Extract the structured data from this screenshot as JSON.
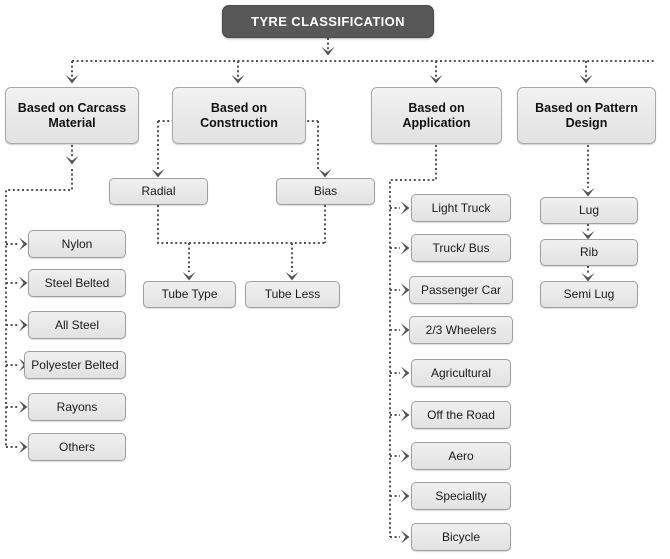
{
  "diagram": {
    "title": "TYRE CLASSIFICATION",
    "colors": {
      "root_bg": "#585858",
      "root_text": "#ffffff",
      "box_bg": "#eaeaea",
      "box_border": "#a8a8a8",
      "connector": "#5a5a5a",
      "page_bg": "#ffffff"
    },
    "categories": [
      {
        "label": "Based on Carcass Material"
      },
      {
        "label": "Based on Construction"
      },
      {
        "label": "Based on Application"
      },
      {
        "label": "Based on Pattern Design"
      }
    ],
    "carcass_material": {
      "heading": "Based on Carcass Material",
      "items": [
        {
          "label": "Nylon"
        },
        {
          "label": "Steel Belted"
        },
        {
          "label": "All Steel"
        },
        {
          "label": "Polyester Belted"
        },
        {
          "label": "Rayons"
        },
        {
          "label": "Others"
        }
      ]
    },
    "construction": {
      "heading": "Based on Construction",
      "types": [
        {
          "label": "Radial"
        },
        {
          "label": "Bias"
        }
      ],
      "subtypes": [
        {
          "label": "Tube Type"
        },
        {
          "label": "Tube Less"
        }
      ]
    },
    "application": {
      "heading": "Based on Application",
      "items": [
        {
          "label": "Light Truck"
        },
        {
          "label": "Truck/ Bus"
        },
        {
          "label": "Passenger Car"
        },
        {
          "label": "2/3 Wheelers"
        },
        {
          "label": "Agricultural"
        },
        {
          "label": "Off the Road"
        },
        {
          "label": "Aero"
        },
        {
          "label": "Speciality"
        },
        {
          "label": "Bicycle"
        }
      ]
    },
    "pattern_design": {
      "heading": "Based on Pattern Design",
      "items": [
        {
          "label": "Lug"
        },
        {
          "label": "Rib"
        },
        {
          "label": "Semi Lug"
        }
      ]
    }
  }
}
